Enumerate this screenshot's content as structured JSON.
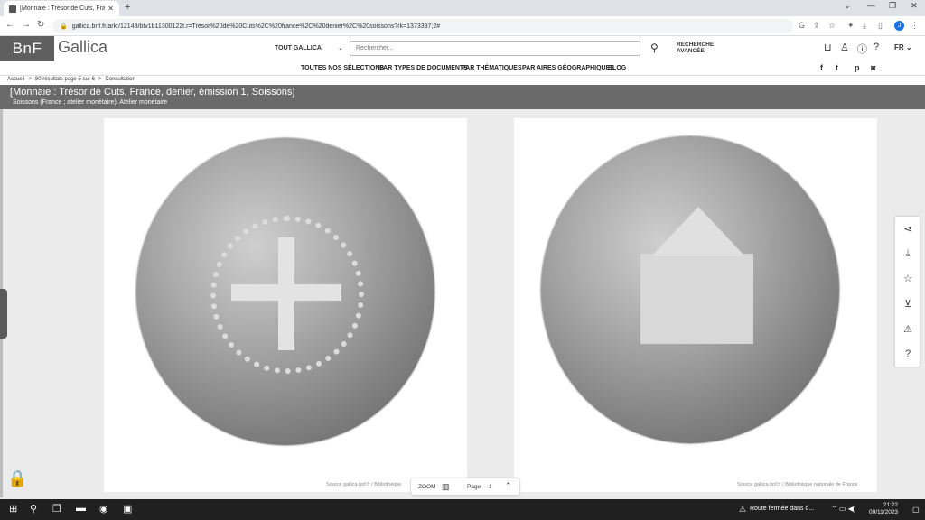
{
  "browser": {
    "tab_title": "[Monnaie : Trésor de Cuts, France…",
    "url": "gallica.bnf.fr/ark:/12148/btv1b11300122t.r=Trésor%20de%20Cuts%2C%20france%2C%20denier%2C%20soissons?rk=1373397;2#",
    "profile_initial": "J"
  },
  "header": {
    "logo": "BnF",
    "brand": "Gallica",
    "scope_select": "TOUT GALLICA",
    "search_placeholder": "Rechercher...",
    "advanced_search": "RECHERCHE AVANCÉE",
    "language": "FR"
  },
  "nav": {
    "items": [
      "TOUTES NOS SÉLECTIONS",
      "PAR TYPES DE DOCUMENTS",
      "PAR THÉMATIQUES",
      "PAR AIRES GÉOGRAPHIQUES",
      "BLOG"
    ]
  },
  "breadcrumb": {
    "home": "Accueil",
    "results": "80 résultats page 5 sur 6",
    "current": "Consultation"
  },
  "document": {
    "title": "[Monnaie : Trésor de Cuts, France, denier, émission 1, Soissons]",
    "subtitle": "Soissons (France ; atelier monétaire). Atelier monétaire"
  },
  "viewer": {
    "left_source": "Source gallica.bnf.fr / Bibliothèque",
    "right_source": "Source gallica.bnf.fr / Bibliothèque nationale de France",
    "zoom_label": "ZOOM",
    "page_label": "Page",
    "page_value": "1"
  },
  "taskbar": {
    "notification": "Route fermée dans d...",
    "time": "21:22",
    "date": "09/11/2023"
  }
}
